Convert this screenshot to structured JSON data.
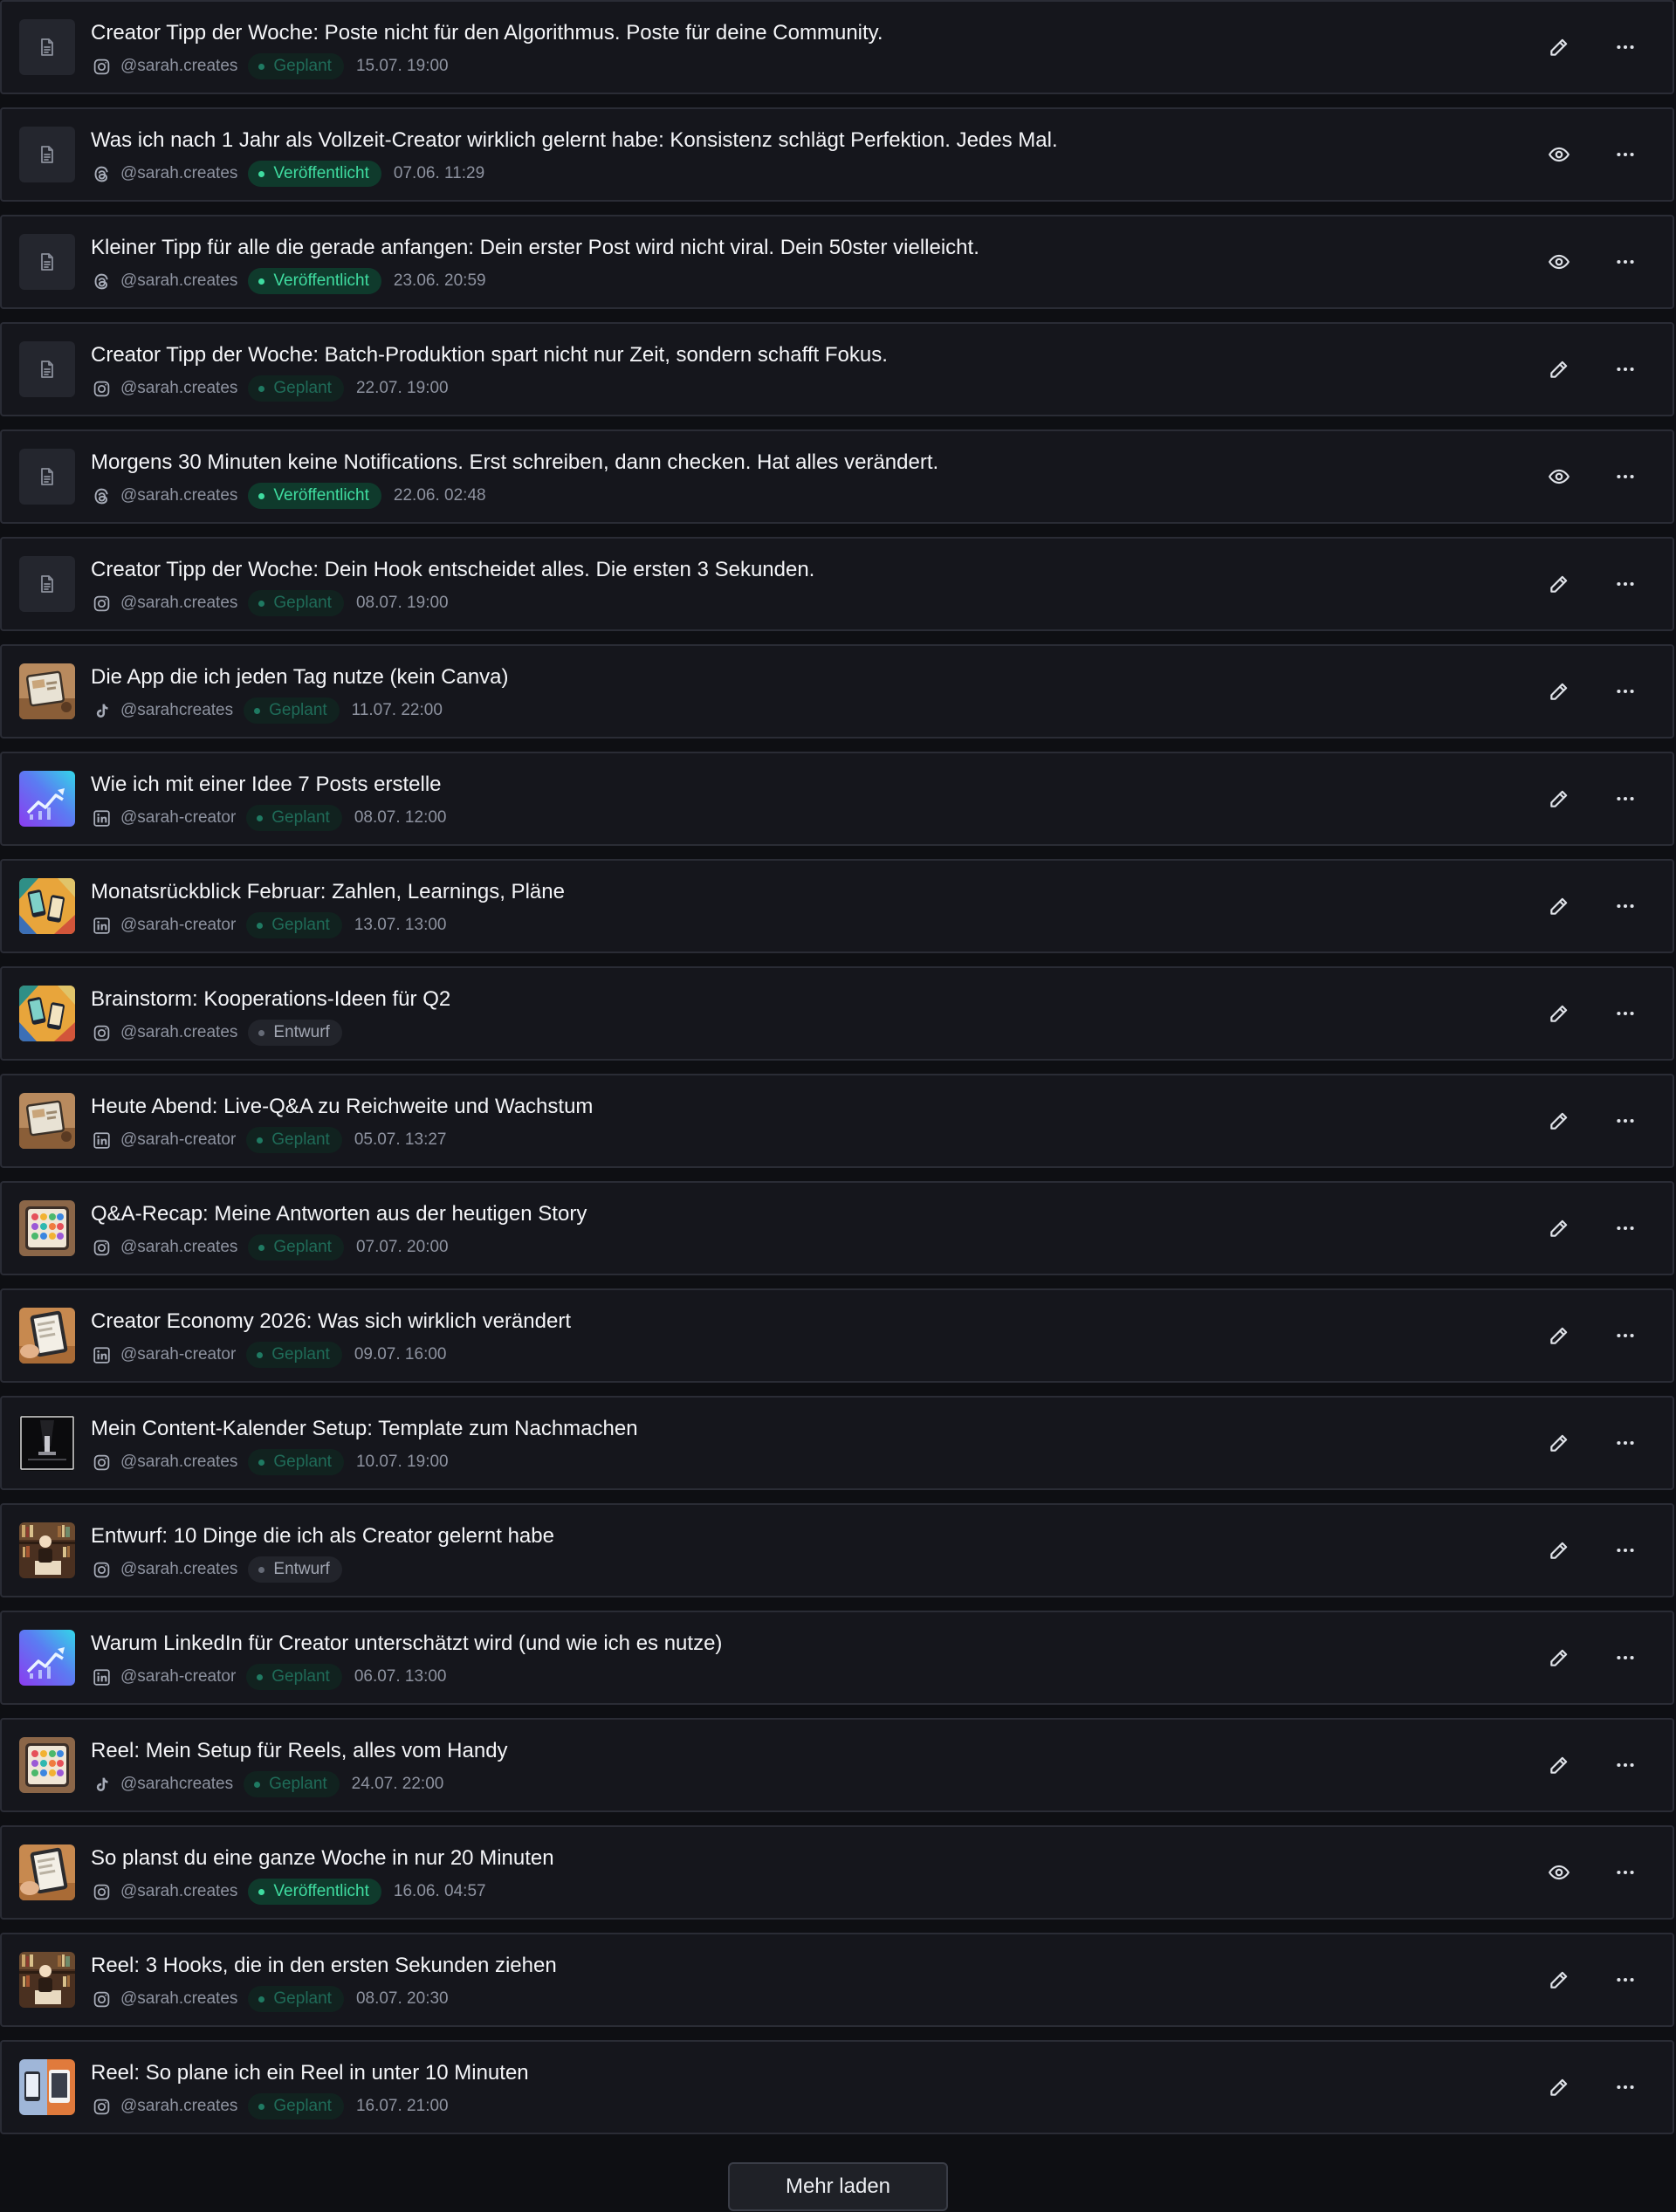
{
  "posts": [
    {
      "title": "Creator Tipp der Woche: Poste nicht für den Algorithmus. Poste für deine Community.",
      "platform_icon": "instagram-icon",
      "handle": "@sarah.creates",
      "status": "Geplant",
      "status_kind": "geplant",
      "date": "15.07. 19:00",
      "action": "edit",
      "thumb": "doc"
    },
    {
      "title": "Was ich nach 1 Jahr als Vollzeit-Creator wirklich gelernt habe: Konsistenz schlägt Perfektion. Jedes Mal.",
      "platform_icon": "threads-icon",
      "handle": "@sarah.creates",
      "status": "Veröffentlicht",
      "status_kind": "veroeffentlicht",
      "date": "07.06. 11:29",
      "action": "view",
      "thumb": "doc"
    },
    {
      "title": "Kleiner Tipp für alle die gerade anfangen: Dein erster Post wird nicht viral. Dein 50ster vielleicht.",
      "platform_icon": "threads-icon",
      "handle": "@sarah.creates",
      "status": "Veröffentlicht",
      "status_kind": "veroeffentlicht",
      "date": "23.06. 20:59",
      "action": "view",
      "thumb": "doc"
    },
    {
      "title": "Creator Tipp der Woche: Batch-Produktion spart nicht nur Zeit, sondern schafft Fokus.",
      "platform_icon": "instagram-icon",
      "handle": "@sarah.creates",
      "status": "Geplant",
      "status_kind": "geplant",
      "date": "22.07. 19:00",
      "action": "edit",
      "thumb": "doc"
    },
    {
      "title": "Morgens 30 Minuten keine Notifications. Erst schreiben, dann checken. Hat alles verändert.",
      "platform_icon": "threads-icon",
      "handle": "@sarah.creates",
      "status": "Veröffentlicht",
      "status_kind": "veroeffentlicht",
      "date": "22.06. 02:48",
      "action": "view",
      "thumb": "doc"
    },
    {
      "title": "Creator Tipp der Woche: Dein Hook entscheidet alles. Die ersten 3 Sekunden.",
      "platform_icon": "instagram-icon",
      "handle": "@sarah.creates",
      "status": "Geplant",
      "status_kind": "geplant",
      "date": "08.07. 19:00",
      "action": "edit",
      "thumb": "doc"
    },
    {
      "title": "Die App die ich jeden Tag nutze (kein Canva)",
      "platform_icon": "tiktok-icon",
      "handle": "@sarahcreates",
      "status": "Geplant",
      "status_kind": "geplant",
      "date": "11.07. 22:00",
      "action": "edit",
      "thumb": "tablet-desk"
    },
    {
      "title": "Wie ich mit einer Idee 7 Posts erstelle",
      "platform_icon": "linkedin-icon",
      "handle": "@sarah-creator",
      "status": "Geplant",
      "status_kind": "geplant",
      "date": "08.07. 12:00",
      "action": "edit",
      "thumb": "growth-chart"
    },
    {
      "title": "Monatsrückblick Februar: Zahlen, Learnings, Pläne",
      "platform_icon": "linkedin-icon",
      "handle": "@sarah-creator",
      "status": "Geplant",
      "status_kind": "geplant",
      "date": "13.07. 13:00",
      "action": "edit",
      "thumb": "phones-collage"
    },
    {
      "title": "Brainstorm: Kooperations-Ideen für Q2",
      "platform_icon": "instagram-icon",
      "handle": "@sarah.creates",
      "status": "Entwurf",
      "status_kind": "entwurf",
      "date": "",
      "action": "edit",
      "thumb": "phones-collage"
    },
    {
      "title": "Heute Abend: Live-Q&A zu Reichweite und Wachstum",
      "platform_icon": "linkedin-icon",
      "handle": "@sarah-creator",
      "status": "Geplant",
      "status_kind": "geplant",
      "date": "05.07. 13:27",
      "action": "edit",
      "thumb": "tablet-desk"
    },
    {
      "title": "Q&A-Recap: Meine Antworten aus der heutigen Story",
      "platform_icon": "instagram-icon",
      "handle": "@sarah.creates",
      "status": "Geplant",
      "status_kind": "geplant",
      "date": "07.07. 20:00",
      "action": "edit",
      "thumb": "app-grid"
    },
    {
      "title": "Creator Economy 2026: Was sich wirklich verändert",
      "platform_icon": "linkedin-icon",
      "handle": "@sarah-creator",
      "status": "Geplant",
      "status_kind": "geplant",
      "date": "09.07. 16:00",
      "action": "edit",
      "thumb": "tablet-hand"
    },
    {
      "title": "Mein Content-Kalender Setup: Template zum Nachmachen",
      "platform_icon": "instagram-icon",
      "handle": "@sarah.creates",
      "status": "Geplant",
      "status_kind": "geplant",
      "date": "10.07. 19:00",
      "action": "edit",
      "thumb": "dark-stage"
    },
    {
      "title": "Entwurf: 10 Dinge die ich als Creator gelernt habe",
      "platform_icon": "instagram-icon",
      "handle": "@sarah.creates",
      "status": "Entwurf",
      "status_kind": "entwurf",
      "date": "",
      "action": "edit",
      "thumb": "library"
    },
    {
      "title": "Warum LinkedIn für Creator unterschätzt wird (und wie ich es nutze)",
      "platform_icon": "linkedin-icon",
      "handle": "@sarah-creator",
      "status": "Geplant",
      "status_kind": "geplant",
      "date": "06.07. 13:00",
      "action": "edit",
      "thumb": "growth-chart"
    },
    {
      "title": "Reel: Mein Setup für Reels, alles vom Handy",
      "platform_icon": "tiktok-icon",
      "handle": "@sarahcreates",
      "status": "Geplant",
      "status_kind": "geplant",
      "date": "24.07. 22:00",
      "action": "edit",
      "thumb": "app-grid"
    },
    {
      "title": "So planst du eine ganze Woche in nur 20 Minuten",
      "platform_icon": "instagram-icon",
      "handle": "@sarah.creates",
      "status": "Veröffentlicht",
      "status_kind": "veroeffentlicht",
      "date": "16.06. 04:57",
      "action": "view",
      "thumb": "tablet-hand"
    },
    {
      "title": "Reel: 3 Hooks, die in den ersten Sekunden ziehen",
      "platform_icon": "instagram-icon",
      "handle": "@sarah.creates",
      "status": "Geplant",
      "status_kind": "geplant",
      "date": "08.07. 20:30",
      "action": "edit",
      "thumb": "library"
    },
    {
      "title": "Reel: So plane ich ein Reel in unter 10 Minuten",
      "platform_icon": "instagram-icon",
      "handle": "@sarah.creates",
      "status": "Geplant",
      "status_kind": "geplant",
      "date": "16.07. 21:00",
      "action": "edit",
      "thumb": "split-devices"
    }
  ],
  "load_more_label": "Mehr laden"
}
